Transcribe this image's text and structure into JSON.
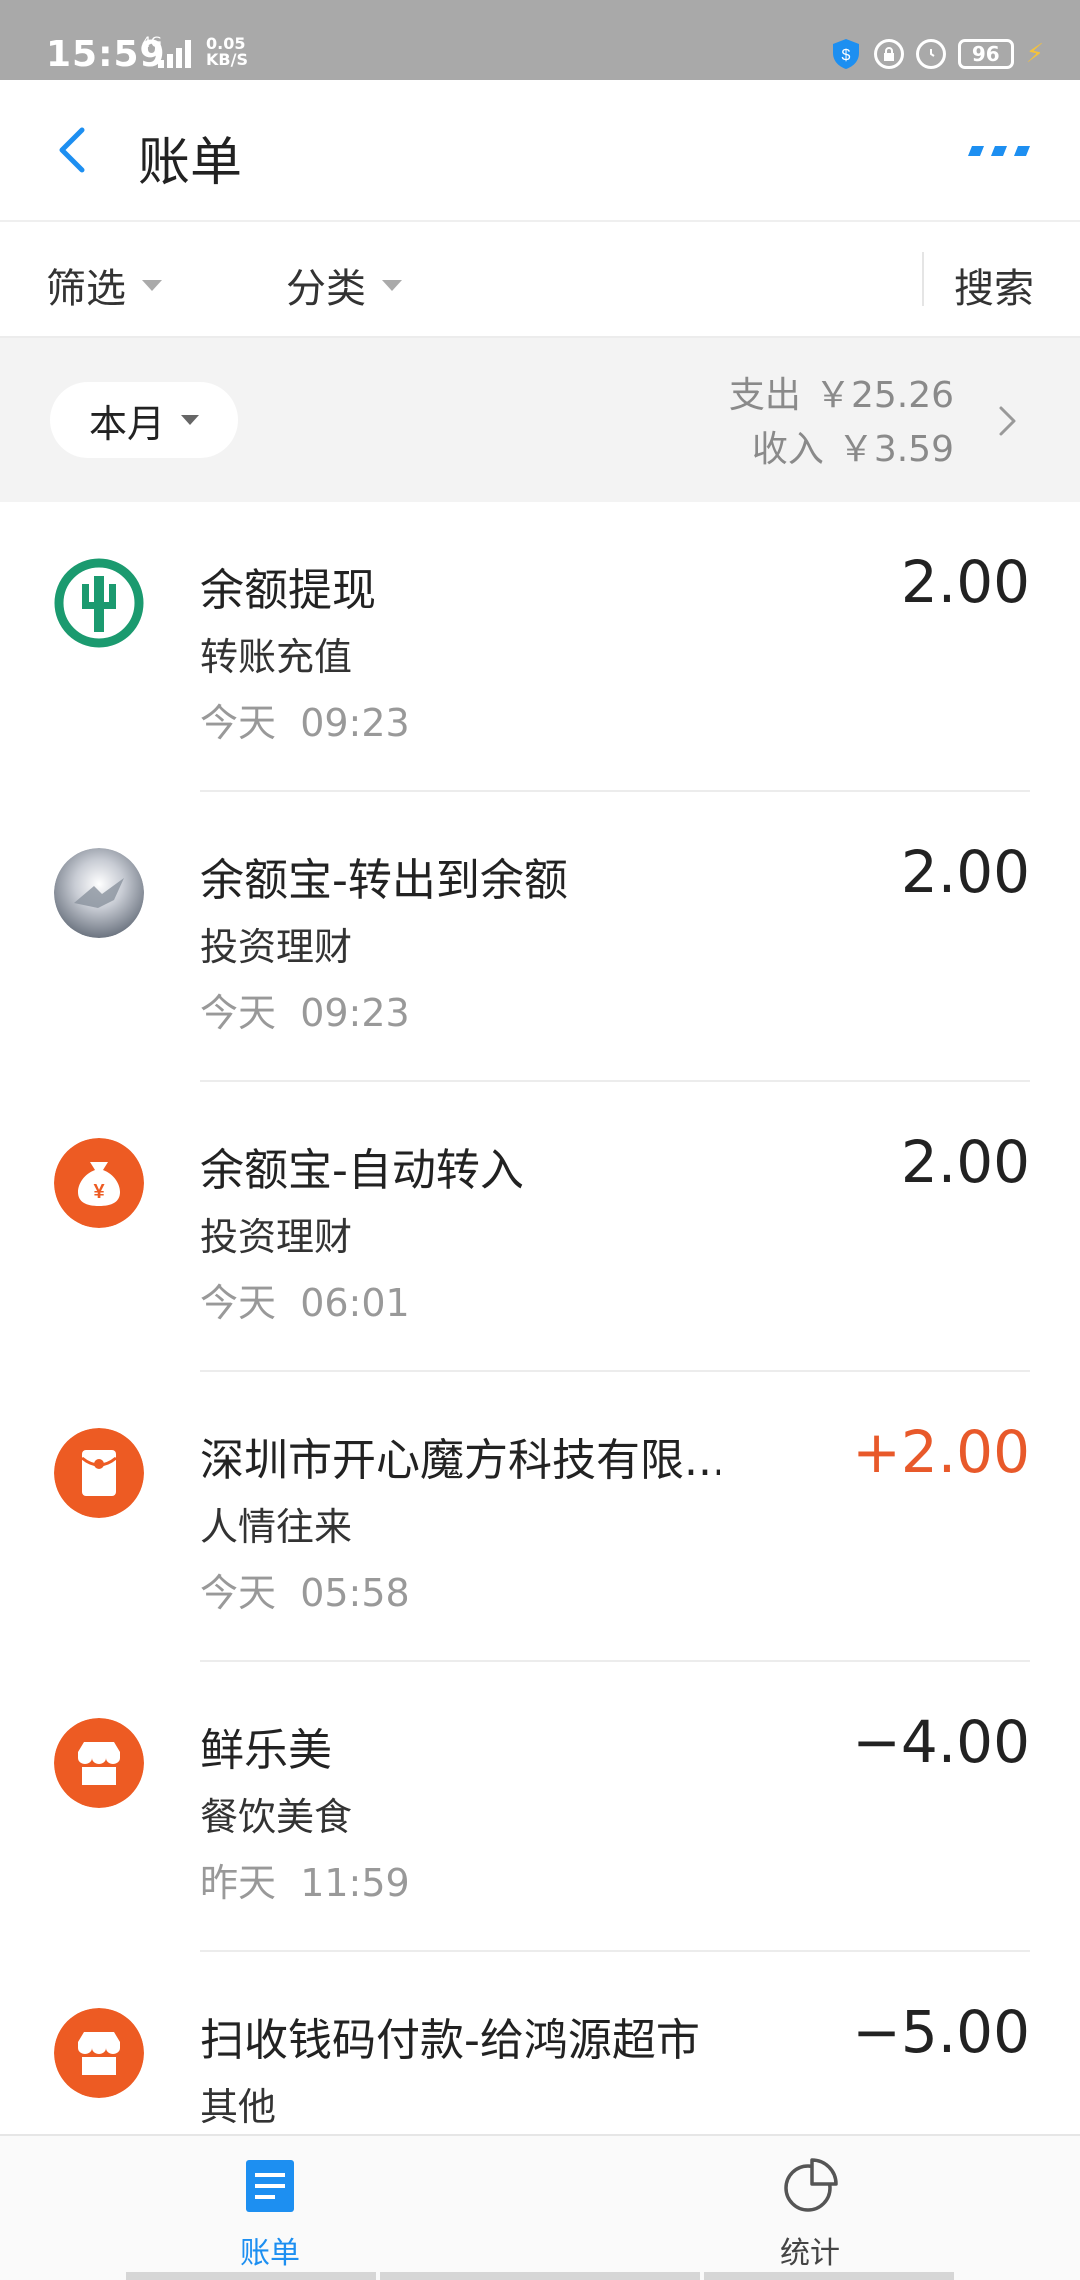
{
  "status_bar": {
    "time": "15:59",
    "network": "4G",
    "speed_value": "0.05",
    "speed_unit": "KB/S",
    "battery": "96"
  },
  "header": {
    "title": "账单"
  },
  "filters": {
    "filter_label": "筛选",
    "category_label": "分类",
    "search_label": "搜索"
  },
  "summary": {
    "month_label": "本月",
    "expense_label": "支出",
    "expense_value": "￥25.26",
    "income_label": "收入",
    "income_value": "￥3.59"
  },
  "transactions": [
    {
      "title": "余额提现",
      "category": "转账充值",
      "date": "今天",
      "time": "09:23",
      "amount": "2.00",
      "icon": "bank-logo-icon"
    },
    {
      "title": "余额宝-转出到余额",
      "category": "投资理财",
      "date": "今天",
      "time": "09:23",
      "amount": "2.00",
      "icon": "avatar-photo"
    },
    {
      "title": "余额宝-自动转入",
      "category": "投资理财",
      "date": "今天",
      "time": "06:01",
      "amount": "2.00",
      "icon": "money-bag-icon"
    },
    {
      "title": "深圳市开心魔方科技有限...",
      "category": "人情往来",
      "date": "今天",
      "time": "05:58",
      "amount": "+2.00",
      "icon": "red-envelope-icon"
    },
    {
      "title": "鲜乐美",
      "category": "餐饮美食",
      "date": "昨天",
      "time": "11:59",
      "amount": "−4.00",
      "icon": "store-icon"
    },
    {
      "title": "扫收钱码付款-给鸿源超市",
      "category": "其他",
      "date": "",
      "time": "",
      "amount": "−5.00",
      "icon": "store-icon"
    }
  ],
  "tabs": {
    "bill_label": "账单",
    "stats_label": "统计"
  },
  "colors": {
    "accent_blue": "#1d8ff1",
    "positive_orange": "#e8592a",
    "bank_green": "#1b9a6f",
    "icon_orange": "#ed5b23"
  }
}
